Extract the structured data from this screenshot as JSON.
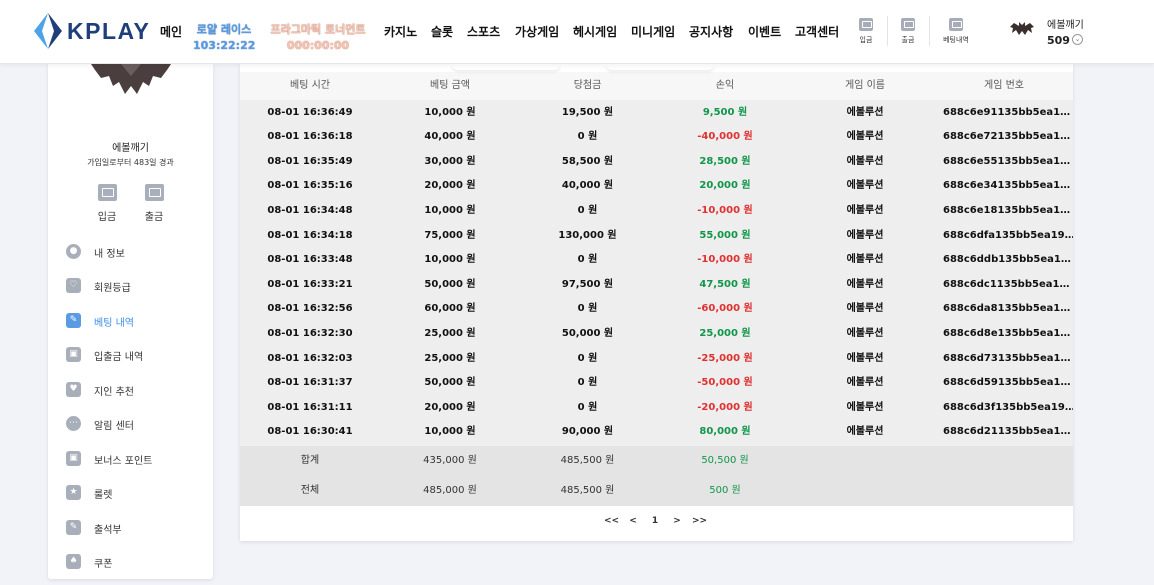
{
  "brand": {
    "name": "KPLAY",
    "colors": {
      "accent": "#3a8ee6",
      "positive": "#109648",
      "negative": "#e03030",
      "logo_dark": "#1f3e7a",
      "logo_light": "#4da3e8"
    }
  },
  "nav": {
    "items": [
      {
        "label": "메인"
      },
      {
        "label": "카지노"
      },
      {
        "label": "슬롯"
      },
      {
        "label": "스포츠"
      },
      {
        "label": "가상게임"
      },
      {
        "label": "헤시게임"
      },
      {
        "label": "미니게임"
      },
      {
        "label": "공지사항"
      },
      {
        "label": "이벤트"
      },
      {
        "label": "고객센터"
      }
    ],
    "special": [
      {
        "label": "로얄 레이스",
        "timer": "103:22:22"
      },
      {
        "label": "프라그마틱 토너먼트",
        "timer": "000:00:00"
      }
    ],
    "buttons": [
      {
        "label": "입금",
        "icon": "deposit-icon"
      },
      {
        "label": "출금",
        "icon": "withdraw-icon"
      },
      {
        "label": "베팅내역",
        "icon": "bet-history-icon"
      }
    ]
  },
  "user": {
    "name": "에볼깨기",
    "money": "509",
    "since": "가입일로부터 483일 경과"
  },
  "sidebar": {
    "wallet": [
      {
        "label": "입금",
        "icon": "wallet-icon"
      },
      {
        "label": "출금",
        "icon": "wallet-icon"
      }
    ],
    "menu": [
      {
        "label": "내 정보",
        "icon": "user-icon"
      },
      {
        "label": "회원등급",
        "icon": "badge-icon"
      },
      {
        "label": "베팅 내역",
        "icon": "edit-icon",
        "active": true
      },
      {
        "label": "입출금 내역",
        "icon": "wallet-icon"
      },
      {
        "label": "지인 추천",
        "icon": "heart-icon"
      },
      {
        "label": "알림 센터",
        "icon": "chat-icon"
      },
      {
        "label": "보너스 포인트",
        "icon": "wallet-icon"
      },
      {
        "label": "룰렛",
        "icon": "roulette-icon"
      },
      {
        "label": "출석부",
        "icon": "edit-icon"
      },
      {
        "label": "쿠폰",
        "icon": "coupon-icon"
      }
    ]
  },
  "table": {
    "headers": [
      "베팅 시간",
      "베팅 금액",
      "당첨금",
      "손익",
      "게임 이름",
      "게임 번호"
    ],
    "rows": [
      {
        "time": "08-01 16:36:49",
        "bet": "10,000 원",
        "win": "19,500 원",
        "pl": "9,500 원",
        "pl_sign": "pos",
        "game": "에볼루션",
        "id": "688c6e91135bb5ea1…"
      },
      {
        "time": "08-01 16:36:18",
        "bet": "40,000 원",
        "win": "0 원",
        "pl": "-40,000 원",
        "pl_sign": "neg",
        "game": "에볼루션",
        "id": "688c6e72135bb5ea1…"
      },
      {
        "time": "08-01 16:35:49",
        "bet": "30,000 원",
        "win": "58,500 원",
        "pl": "28,500 원",
        "pl_sign": "pos",
        "game": "에볼루션",
        "id": "688c6e55135bb5ea1…"
      },
      {
        "time": "08-01 16:35:16",
        "bet": "20,000 원",
        "win": "40,000 원",
        "pl": "20,000 원",
        "pl_sign": "pos",
        "game": "에볼루션",
        "id": "688c6e34135bb5ea1…"
      },
      {
        "time": "08-01 16:34:48",
        "bet": "10,000 원",
        "win": "0 원",
        "pl": "-10,000 원",
        "pl_sign": "neg",
        "game": "에볼루션",
        "id": "688c6e18135bb5ea1…"
      },
      {
        "time": "08-01 16:34:18",
        "bet": "75,000 원",
        "win": "130,000 원",
        "pl": "55,000 원",
        "pl_sign": "pos",
        "game": "에볼루션",
        "id": "688c6dfa135bb5ea19…"
      },
      {
        "time": "08-01 16:33:48",
        "bet": "10,000 원",
        "win": "0 원",
        "pl": "-10,000 원",
        "pl_sign": "neg",
        "game": "에볼루션",
        "id": "688c6ddb135bb5ea1…"
      },
      {
        "time": "08-01 16:33:21",
        "bet": "50,000 원",
        "win": "97,500 원",
        "pl": "47,500 원",
        "pl_sign": "pos",
        "game": "에볼루션",
        "id": "688c6dc1135bb5ea1…"
      },
      {
        "time": "08-01 16:32:56",
        "bet": "60,000 원",
        "win": "0 원",
        "pl": "-60,000 원",
        "pl_sign": "neg",
        "game": "에볼루션",
        "id": "688c6da8135bb5ea1…"
      },
      {
        "time": "08-01 16:32:30",
        "bet": "25,000 원",
        "win": "50,000 원",
        "pl": "25,000 원",
        "pl_sign": "pos",
        "game": "에볼루션",
        "id": "688c6d8e135bb5ea1…"
      },
      {
        "time": "08-01 16:32:03",
        "bet": "25,000 원",
        "win": "0 원",
        "pl": "-25,000 원",
        "pl_sign": "neg",
        "game": "에볼루션",
        "id": "688c6d73135bb5ea1…"
      },
      {
        "time": "08-01 16:31:37",
        "bet": "50,000 원",
        "win": "0 원",
        "pl": "-50,000 원",
        "pl_sign": "neg",
        "game": "에볼루션",
        "id": "688c6d59135bb5ea1…"
      },
      {
        "time": "08-01 16:31:11",
        "bet": "20,000 원",
        "win": "0 원",
        "pl": "-20,000 원",
        "pl_sign": "neg",
        "game": "에볼루션",
        "id": "688c6d3f135bb5ea19…"
      },
      {
        "time": "08-01 16:30:41",
        "bet": "10,000 원",
        "win": "90,000 원",
        "pl": "80,000 원",
        "pl_sign": "pos",
        "game": "에볼루션",
        "id": "688c6d21135bb5ea1…"
      }
    ],
    "summary": [
      {
        "label": "합계",
        "bet": "435,000 원",
        "win": "485,500 원",
        "pl": "50,500 원"
      },
      {
        "label": "전체",
        "bet": "485,000 원",
        "win": "485,500 원",
        "pl": "500 원"
      }
    ]
  },
  "pagination": {
    "first": "<<",
    "prev": "<",
    "current": "1",
    "next": ">",
    "last": ">>"
  }
}
